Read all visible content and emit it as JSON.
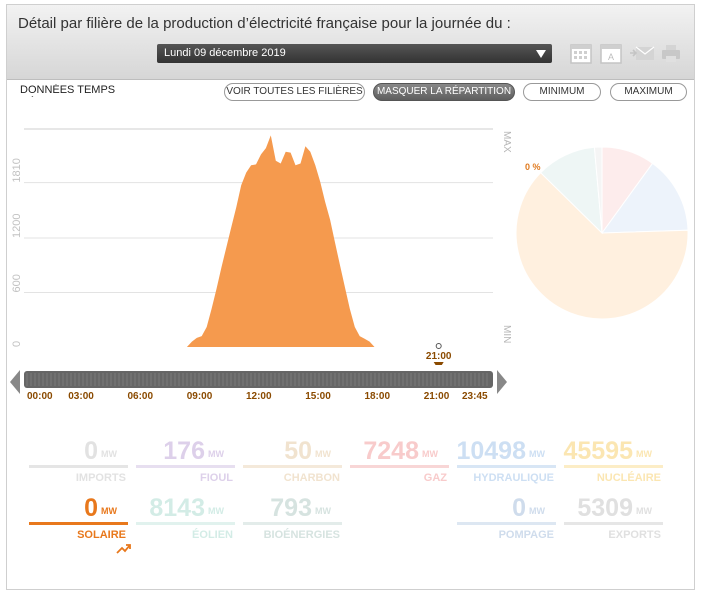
{
  "header": {
    "title": "Détail par filière de la production d’électricité française pour la journée du :",
    "date_selected": "Lundi 09 décembre 2019"
  },
  "controls": {
    "realtime_label": "DONNÉES TEMPS RÉEL",
    "btn_all": "VOIR TOUTES LES FILIÈRES",
    "btn_hide": "MASQUER LA RÉPARTITION",
    "btn_min": "MINIMUM",
    "btn_max": "MAXIMUM"
  },
  "chart_data": {
    "type": "area",
    "series": [
      {
        "color": "#f59a4e",
        "x": [
          "08:15",
          "08:30",
          "08:45",
          "09:00",
          "09:15",
          "09:30",
          "09:45",
          "10:00",
          "10:15",
          "10:30",
          "10:45",
          "11:00",
          "11:15",
          "11:30",
          "11:45",
          "12:00",
          "12:15",
          "12:30",
          "12:45",
          "13:00",
          "13:15",
          "13:30",
          "13:45",
          "14:00",
          "14:15",
          "14:30",
          "14:45",
          "15:00",
          "15:15",
          "15:30",
          "15:45",
          "16:00",
          "16:15",
          "16:30",
          "16:45",
          "17:00",
          "17:15",
          "17:30",
          "17:45"
        ],
        "values": [
          0,
          60,
          100,
          120,
          220,
          420,
          640,
          880,
          1100,
          1320,
          1540,
          1780,
          1920,
          2000,
          2010,
          2120,
          2190,
          2330,
          2050,
          2020,
          2150,
          2140,
          2000,
          2020,
          2210,
          2150,
          2000,
          1820,
          1600,
          1400,
          1150,
          900,
          660,
          420,
          220,
          120,
          90,
          60,
          0
        ]
      }
    ],
    "y_ticks": [
      "0",
      "600",
      "1200",
      "1810"
    ],
    "ylim": [
      0,
      2400
    ],
    "y_max_label": "MAX",
    "y_min_label": "MIN",
    "x_ticks": [
      "00:00",
      "03:00",
      "06:00",
      "09:00",
      "12:00",
      "15:00",
      "18:00",
      "21:00",
      "23:45"
    ],
    "xlim_hours": [
      0,
      23.75
    ],
    "cursor": {
      "time": "21:00",
      "hour": 21
    }
  },
  "pie": {
    "label": "0 %",
    "slices": [
      {
        "source": "nucleaire",
        "value": 45595,
        "color": "#fff0df"
      },
      {
        "source": "hydraulique",
        "value": 10498,
        "color": "#edf3fb"
      },
      {
        "source": "gaz",
        "value": 7248,
        "color": "#fdecec"
      },
      {
        "source": "eolien",
        "value": 8143,
        "color": "#eef6f5"
      },
      {
        "source": "autres",
        "value": 1019,
        "color": "#f5f5f5"
      }
    ]
  },
  "unit": "MW",
  "sources": [
    {
      "id": "imports",
      "value": "0",
      "name": "IMPORTS",
      "color": "#e2e2e2",
      "bar": "#e5e5e5"
    },
    {
      "id": "fioul",
      "value": "176",
      "name": "FIOUL",
      "color": "#ddd0ea",
      "bar": "#e7dff0"
    },
    {
      "id": "charbon",
      "value": "50",
      "name": "CHARBON",
      "color": "#f1e3cf",
      "bar": "#f4e9da"
    },
    {
      "id": "gaz",
      "value": "7248",
      "name": "GAZ",
      "color": "#f8cbcb",
      "bar": "#f8d6d6"
    },
    {
      "id": "hydraulique",
      "value": "10498",
      "name": "HYDRAULIQUE",
      "color": "#cddff3",
      "bar": "#d8e6f5"
    },
    {
      "id": "nucleaire",
      "value": "45595",
      "name": "NUCLÉAIRE",
      "color": "#fbe6b2",
      "bar": "#fcedc6"
    },
    {
      "id": "solaire",
      "value": "0",
      "name": "SOLAIRE",
      "color": "#e8781c",
      "bar": "#e8781c"
    },
    {
      "id": "eolien",
      "value": "8143",
      "name": "ÉOLIEN",
      "color": "#d3ece6",
      "bar": "#e1f2ee"
    },
    {
      "id": "bioenergies",
      "value": "793",
      "name": "BIOÉNERGIES",
      "color": "#d6e3e0",
      "bar": "#e3ecea"
    },
    {
      "id": "pompage",
      "value": "0",
      "name": "POMPAGE",
      "color": "#cfdcec",
      "bar": "#dde7f2"
    },
    {
      "id": "exports",
      "value": "5309",
      "name": "EXPORTS",
      "color": "#e0e0e0",
      "bar": "#e6e6e6"
    }
  ]
}
